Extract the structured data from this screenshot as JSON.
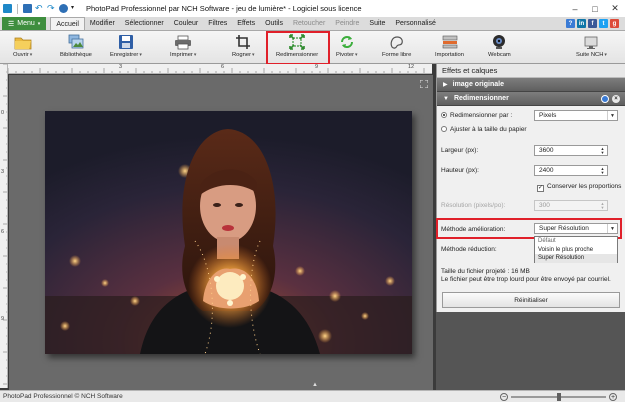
{
  "window": {
    "title": "PhotoPad Professionnel par NCH Software - jeu de lumière* - Logiciel sous licence",
    "controls": [
      "–",
      "□",
      "✕"
    ]
  },
  "tabs": {
    "menu_label": "Menu",
    "items": [
      {
        "label": "Accueil",
        "active": true
      },
      {
        "label": "Modifier"
      },
      {
        "label": "Sélectionner"
      },
      {
        "label": "Couleur"
      },
      {
        "label": "Filtres"
      },
      {
        "label": "Effets"
      },
      {
        "label": "Outils"
      },
      {
        "label": "Retoucher",
        "faded": true
      },
      {
        "label": "Peindre",
        "faded": true
      },
      {
        "label": "Suite"
      },
      {
        "label": "Personnalisé"
      }
    ],
    "social": [
      "?",
      "in",
      "f",
      "t",
      "g"
    ]
  },
  "toolbar": {
    "open": "Ouvrir",
    "library": "Bibliothèque",
    "save": "Enregistrer",
    "print": "Imprimer",
    "crop": "Rogner",
    "resize": "Redimensionner",
    "rotate": "Pivoter",
    "free_shape": "Forme libre",
    "import": "Importation",
    "webcam": "Webcam",
    "suite": "Suite NCH"
  },
  "ruler": {
    "top": [
      "3",
      "6",
      "9",
      "12"
    ],
    "left": [
      "0",
      "3",
      "6",
      "9"
    ]
  },
  "panel": {
    "header": "Effets et calques",
    "section_original": "image originale",
    "section_resize": "Redimensionner",
    "resize_by_label": "Redimensionner par :",
    "resize_by_value": "Pixels",
    "fit_paper_label": "Ajuster à la taille du papier",
    "width_label": "Largeur (px):",
    "width_value": "3600",
    "height_label": "Hauteur (px):",
    "height_value": "2400",
    "keep_ratio_label": "Conserver les proportions",
    "resolution_label": "Résolution (pixels/po):",
    "resolution_value": "300",
    "upscale_label": "Méthode amélioration:",
    "upscale_value": "Super Résolution",
    "downscale_label": "Méthode réduction:",
    "dropdown_options": [
      "Défaut",
      "Voisin le plus proche",
      "Super Résolution"
    ],
    "file_size_text": "Taille du fichier projeté : 16 MB",
    "file_warning_text": "Le fichier peut être trop lourd pour être envoyé par courriel.",
    "reset_button": "Réinitialiser"
  },
  "status": {
    "text": "PhotoPad Professionnel © NCH Software",
    "zoom_minus": "−",
    "zoom_plus": "+",
    "zoom_level_fraction": 0.5
  },
  "colors": {
    "accent_green": "#3e8e3e",
    "highlight_red": "#e0202a",
    "section_gray": "#6e6e6e"
  }
}
